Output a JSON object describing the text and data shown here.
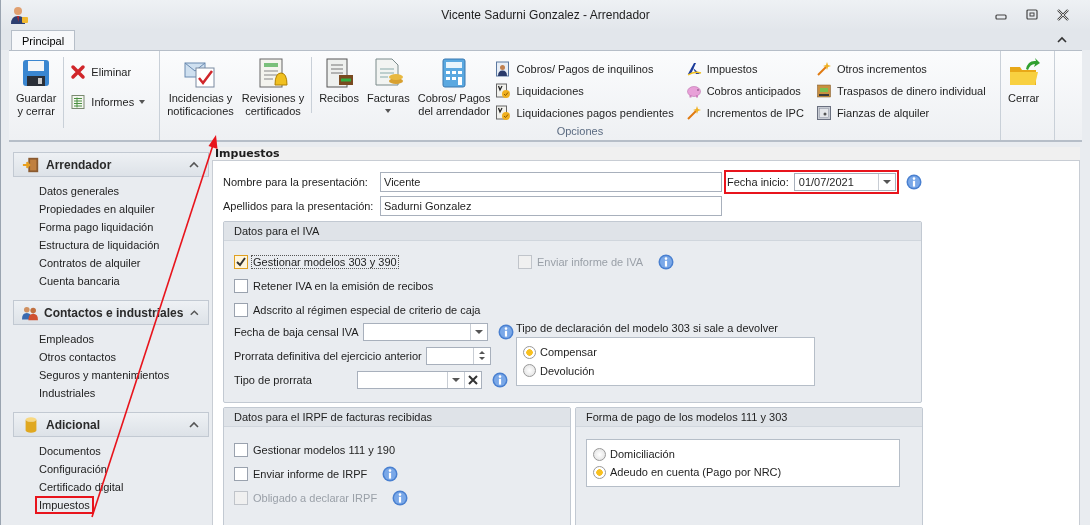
{
  "window": {
    "title": "Vicente Sadurni Gonzalez - Arrendador"
  },
  "tabs": [
    {
      "label": "Principal",
      "selected": true
    }
  ],
  "ribbon": [
    {
      "sections": [
        {
          "divider_before": false,
          "buttons": [
            {
              "kind": "large",
              "label": "Guardar\ny cerrar",
              "dropdown": false
            }
          ]
        },
        {
          "divider_before": true,
          "buttons": [
            {
              "kind": "small",
              "label": "Eliminar",
              "dropdown": false
            },
            {
              "kind": "small",
              "label": "Informes",
              "dropdown": true
            }
          ]
        }
      ]
    },
    {
      "label": "Opciones",
      "sections": [
        {
          "divider_before": false,
          "buttons": [
            {
              "kind": "large",
              "label": "Incidencias y\nnotificaciones",
              "dropdown": false
            },
            {
              "kind": "large",
              "label": "Revisiones y\ncertificados",
              "dropdown": false
            }
          ]
        },
        {
          "divider_before": true,
          "buttons": [
            {
              "kind": "large",
              "label": "Recibos",
              "dropdown": false
            },
            {
              "kind": "large",
              "label": "Facturas",
              "dropdown": true
            },
            {
              "kind": "large",
              "label": "Cobros/ Pagos\ndel arrendador",
              "dropdown": false
            }
          ]
        },
        {
          "divider_before": false,
          "buttons": [
            {
              "kind": "small",
              "label": "Cobros/ Pagos de inquilinos",
              "dropdown": false
            },
            {
              "kind": "small",
              "label": "Liquidaciones",
              "dropdown": false
            },
            {
              "kind": "small",
              "label": "Liquidaciones pagos pendientes",
              "dropdown": false
            }
          ]
        },
        {
          "divider_before": false,
          "buttons": [
            {
              "kind": "small",
              "label": "Impuestos",
              "dropdown": false
            },
            {
              "kind": "small",
              "label": "Cobros anticipados",
              "dropdown": false
            },
            {
              "kind": "small",
              "label": "Incrementos de IPC",
              "dropdown": false
            }
          ]
        },
        {
          "divider_before": false,
          "buttons": [
            {
              "kind": "small",
              "label": "Otros incrementos",
              "dropdown": false
            },
            {
              "kind": "small",
              "label": "Traspasos de dinero individual",
              "dropdown": false
            },
            {
              "kind": "small",
              "label": "Fianzas de alquiler",
              "dropdown": false
            }
          ]
        }
      ]
    },
    {
      "sections": [
        {
          "divider_before": false,
          "buttons": [
            {
              "kind": "large",
              "label": "Cerrar",
              "dropdown": false
            }
          ]
        }
      ]
    }
  ],
  "sidebar": [
    {
      "title": "Arrendador",
      "expanded": true,
      "items": [
        {
          "label": "Datos generales",
          "highlighted": false
        },
        {
          "label": "Propiedades en alquiler",
          "highlighted": false
        },
        {
          "label": "Forma pago liquidación",
          "highlighted": false
        },
        {
          "label": "Estructura de liquidación",
          "highlighted": false
        },
        {
          "label": "Contratos de alquiler",
          "highlighted": false
        },
        {
          "label": "Cuenta bancaria",
          "highlighted": false
        }
      ]
    },
    {
      "title": "Contactos e industriales",
      "expanded": true,
      "items": [
        {
          "label": "Empleados",
          "highlighted": false
        },
        {
          "label": "Otros contactos",
          "highlighted": false
        },
        {
          "label": "Seguros y mantenimientos",
          "highlighted": false
        },
        {
          "label": "Industriales",
          "highlighted": false
        }
      ]
    },
    {
      "title": "Adicional",
      "expanded": true,
      "items": [
        {
          "label": "Documentos",
          "highlighted": false
        },
        {
          "label": "Configuración",
          "highlighted": false
        },
        {
          "label": "Certificado digital",
          "highlighted": false
        },
        {
          "label": "Impuestos",
          "highlighted": true
        }
      ]
    }
  ],
  "content": {
    "title": "Impuestos",
    "nombre": {
      "label": "Nombre para la presentación:",
      "value": "Vicente"
    },
    "apellidos": {
      "label": "Apellidos para la presentación:",
      "value": "Sadurni Gonzalez"
    },
    "fecha_inicio": {
      "label": "Fecha inicio:",
      "value": "01/07/2021",
      "highlighted": true
    },
    "iva": {
      "title": "Datos para el IVA",
      "checkboxes": [
        {
          "label": "Gestionar modelos 303 y 390",
          "checked": true,
          "disabled": false,
          "focused": true,
          "info": false
        },
        {
          "label": "Enviar informe de IVA",
          "checked": false,
          "disabled": true,
          "focused": false,
          "info": true
        },
        {
          "label": "Retener IVA en la emisión de recibos",
          "checked": false,
          "disabled": false,
          "focused": false,
          "info": false
        },
        {
          "label": "Adscrito al régimen especial de criterio de caja",
          "checked": false,
          "disabled": false,
          "focused": false,
          "info": false
        }
      ],
      "fields": [
        {
          "label": "Fecha de baja censal IVA",
          "kind": "dropdown",
          "info": true
        },
        {
          "label": "Prorrata definitiva del ejercicio anterior",
          "kind": "spinner",
          "info": false
        },
        {
          "label": "Tipo de prorrata",
          "kind": "dropdown-clear",
          "info": true
        }
      ],
      "radio_title": "Tipo de declaración del modelo 303 si sale a devolver",
      "radios": [
        {
          "label": "Compensar",
          "selected": true
        },
        {
          "label": "Devolución",
          "selected": false
        }
      ]
    },
    "irpf": {
      "title": "Datos para el IRPF de facturas recibidas",
      "checkboxes": [
        {
          "label": "Gestionar modelos 111 y 190",
          "checked": false,
          "disabled": false,
          "focused": false,
          "info": false
        },
        {
          "label": "Enviar informe de IRPF",
          "checked": false,
          "disabled": false,
          "focused": false,
          "info": true
        },
        {
          "label": "Obligado a declarar IRPF",
          "checked": false,
          "disabled": true,
          "focused": false,
          "info": true
        }
      ]
    },
    "pago": {
      "title": "Forma de pago de los modelos 111 y 303",
      "radios": [
        {
          "label": "Domiciliación",
          "selected": false
        },
        {
          "label": "Adeudo en cuenta (Pago por NRC)",
          "selected": true
        }
      ]
    }
  }
}
